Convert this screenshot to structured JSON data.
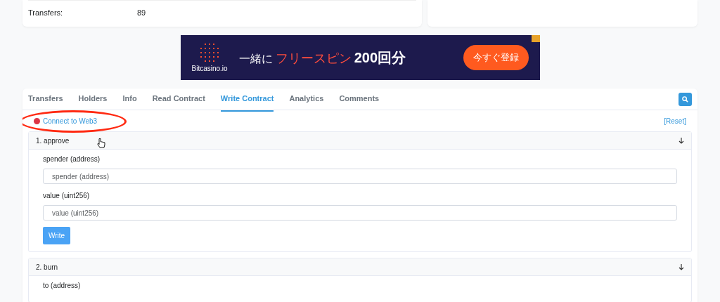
{
  "summary_row": {
    "label": "Transfers:",
    "value": "89"
  },
  "ad": {
    "brand": "Bitcasino.io",
    "lead": "一緒に",
    "highlight": "フリースピン",
    "amount": "200回分",
    "cta": "今すぐ登録"
  },
  "tabs": [
    {
      "label": "Transfers",
      "selected": false
    },
    {
      "label": "Holders",
      "selected": false
    },
    {
      "label": "Info",
      "selected": false
    },
    {
      "label": "Read Contract",
      "selected": false
    },
    {
      "label": "Write Contract",
      "selected": true
    },
    {
      "label": "Analytics",
      "selected": false
    },
    {
      "label": "Comments",
      "selected": false
    }
  ],
  "connect": {
    "label": "Connect to Web3",
    "connected": false,
    "highlighted": true
  },
  "reset": "[Reset]",
  "functions": [
    {
      "title": "1. approve",
      "expanded": true,
      "inputs": [
        {
          "label": "spender (address)",
          "placeholder": "spender (address)"
        },
        {
          "label": "value (uint256)",
          "placeholder": "value (uint256)"
        }
      ],
      "button": "Write"
    },
    {
      "title": "2. burn",
      "expanded": true,
      "inputs": [
        {
          "label": "to (address)"
        }
      ]
    }
  ]
}
